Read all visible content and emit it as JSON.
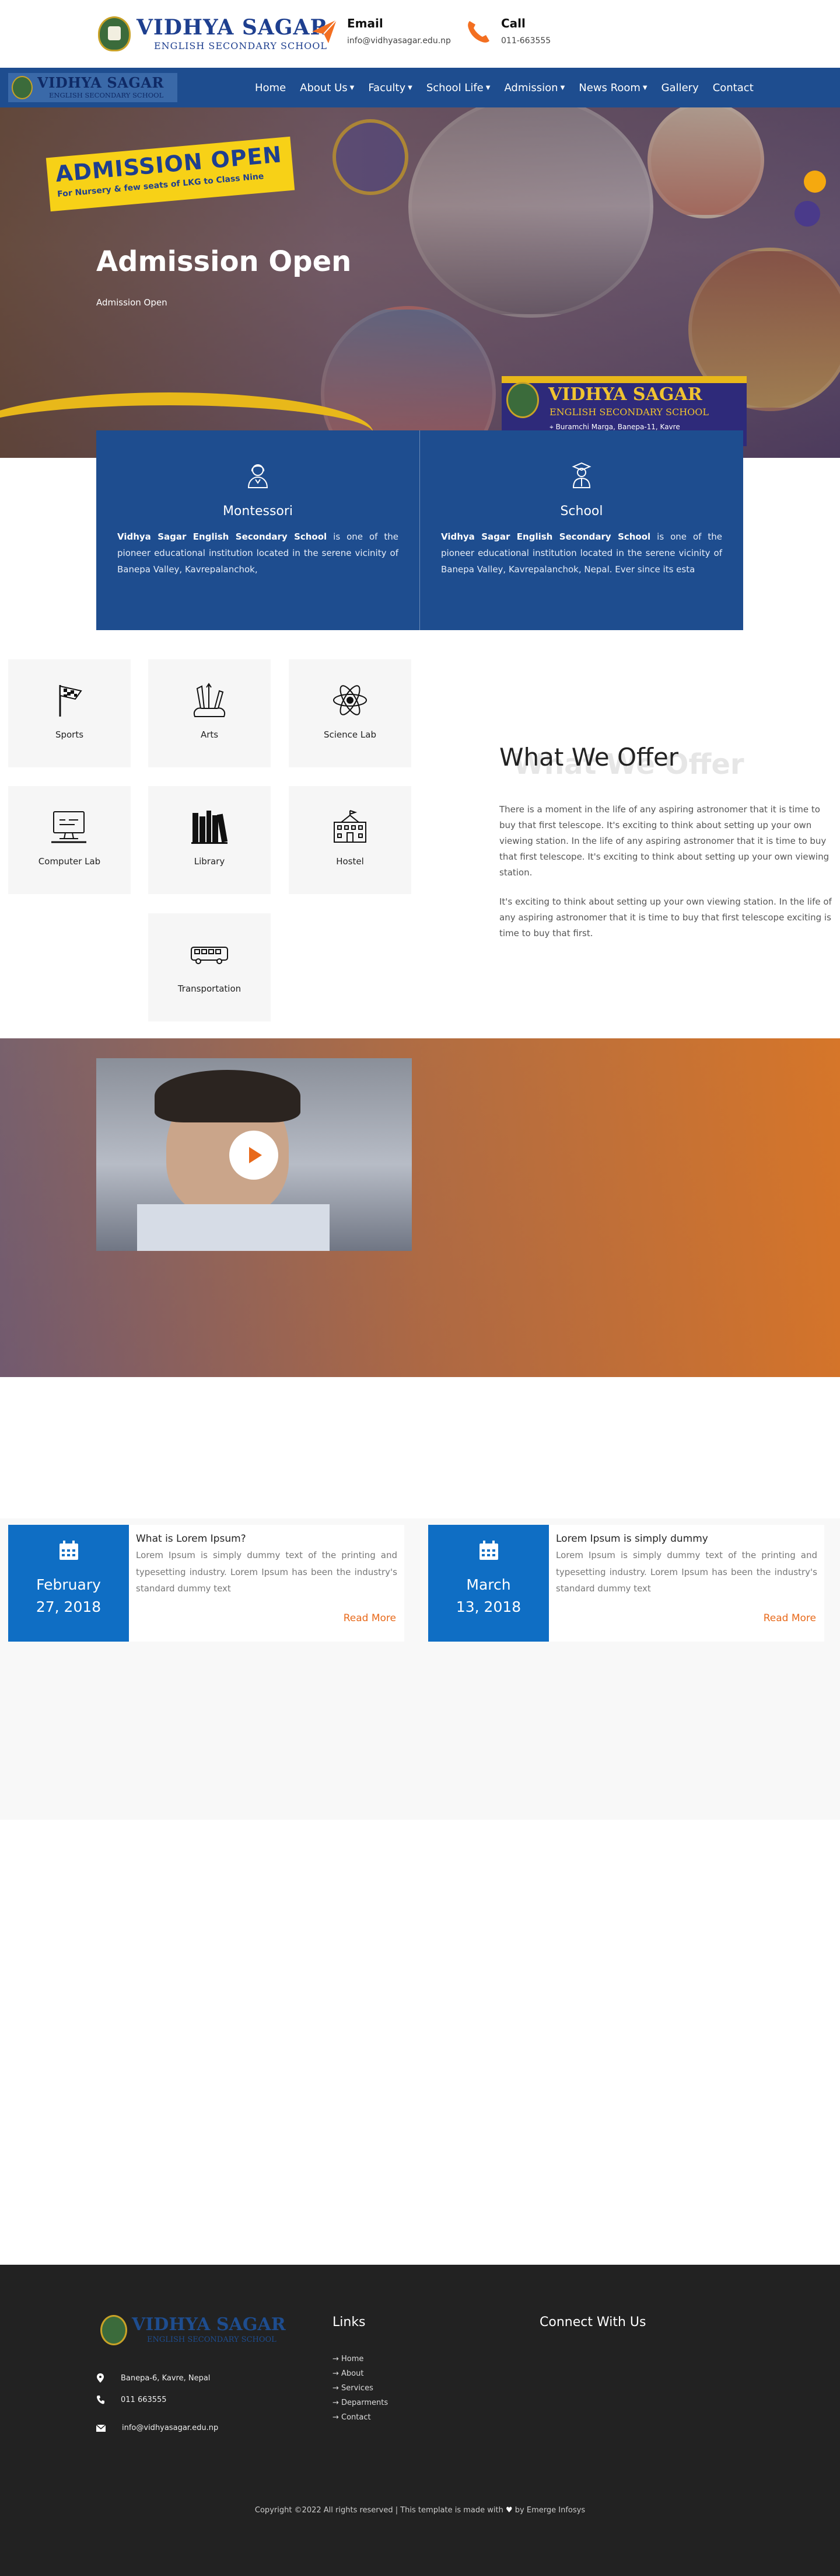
{
  "header": {
    "logo": {
      "title": "VIDHYA SAGAR",
      "subtitle": "ENGLISH SECONDARY SCHOOL"
    },
    "email": {
      "label": "Email",
      "value": "info@vidhyasagar.edu.np"
    },
    "call": {
      "label": "Call",
      "value": "011-663555"
    },
    "accent_color": "#f36f21"
  },
  "nav": {
    "logo": {
      "title": "VIDHYA SAGAR",
      "subtitle": "ENGLISH SECONDARY SCHOOL"
    },
    "bg_color": "#1e4d8f",
    "items": [
      {
        "label": "Home",
        "dropdown": false
      },
      {
        "label": "About Us",
        "dropdown": true
      },
      {
        "label": "Faculty",
        "dropdown": true
      },
      {
        "label": "School Life",
        "dropdown": true
      },
      {
        "label": "Admission",
        "dropdown": true
      },
      {
        "label": "News Room",
        "dropdown": true
      },
      {
        "label": "Gallery",
        "dropdown": false
      },
      {
        "label": "Contact",
        "dropdown": false
      }
    ]
  },
  "hero": {
    "banner_title": "ADMISSION OPEN",
    "banner_subtitle": "For Nursery & few seats of LKG to Class Nine",
    "title": "Admission Open",
    "subtitle": "Admission Open",
    "ribbon_title": "VIDHYA SAGAR",
    "ribbon_subtitle": "ENGLISH SECONDARY SCHOOL",
    "ribbon_address": "Buramchi Marga, Banepa-11, Kavre"
  },
  "panels": [
    {
      "icon": "teacher-icon",
      "title": "Montessori",
      "bold": "Vidhya Sagar English Secondary School",
      "text": " is one of the pioneer educational institution located in the serene vicinity of Banepa Valley, Kavrepalanchok,"
    },
    {
      "icon": "student-icon",
      "title": "School",
      "bold": "Vidhya Sagar English Secondary School",
      "text": " is one of the pioneer educational institution located in the serene vicinity of Banepa Valley, Kavrepalanchok, Nepal. Ever since its esta"
    }
  ],
  "offer": {
    "title": "What We Offer",
    "shadow_title": "What We Offer",
    "paragraphs": [
      "There is a moment in the life of any aspiring astronomer that it is time to buy that first telescope. It's exciting to think about setting up your own viewing station. In the life of any aspiring astronomer that it is time to buy that first telescope. It's exciting to think about setting up your own viewing station.",
      "It's exciting to think about setting up your own viewing station. In the life of any aspiring astronomer that it is time to buy that first telescope exciting is time to buy that first."
    ],
    "items": [
      {
        "label": "Sports",
        "icon": "flag-icon"
      },
      {
        "label": "Arts",
        "icon": "paint-brushes-icon"
      },
      {
        "label": "Science Lab",
        "icon": "atom-icon"
      },
      {
        "label": "Computer Lab",
        "icon": "computer-icon"
      },
      {
        "label": "Library",
        "icon": "books-icon"
      },
      {
        "label": "Hostel",
        "icon": "building-icon"
      },
      {
        "label": "Transportation",
        "icon": "bus-icon"
      }
    ]
  },
  "news": [
    {
      "date_line1": "February",
      "date_line2": "27, 2018",
      "title": "What is Lorem Ipsum?",
      "text": "Lorem Ipsum is simply dummy text of the printing and typesetting industry. Lorem Ipsum has been the industry's standard dummy text",
      "more": "Read More"
    },
    {
      "date_line1": "March",
      "date_line2": "13, 2018",
      "title": "Lorem Ipsum is simply dummy",
      "text": "Lorem Ipsum is simply dummy text of the printing and typesetting industry. Lorem Ipsum has been the industry's standard dummy text",
      "more": "Read More"
    }
  ],
  "footer": {
    "logo": {
      "title": "VIDHYA SAGAR",
      "subtitle": "ENGLISH SECONDARY SCHOOL"
    },
    "address": "Banepa-6, Kavre, Nepal",
    "phone": "011 663555",
    "email": "info@vidhyasagar.edu.np",
    "links_heading": "Links",
    "links": [
      "Home",
      "About",
      "Services",
      "Deparments",
      "Contact"
    ],
    "connect_heading": "Connect With Us",
    "copyright_pre": "Copyright ©2022 All rights reserved | This template is made with",
    "copyright_post": "by Emerge Infosys"
  }
}
